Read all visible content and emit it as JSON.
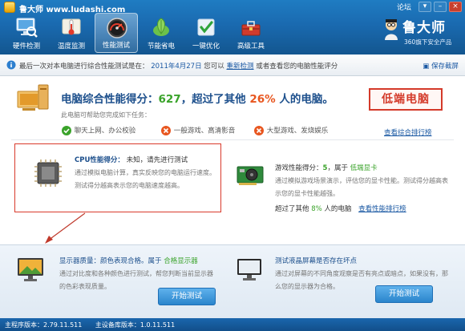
{
  "titlebar": {
    "app_name": "鲁大师 www.ludashi.com",
    "forum": "论坛",
    "menu_glyph": "▾",
    "min_glyph": "–",
    "close_glyph": "×"
  },
  "nav": [
    {
      "label": "硬件检测",
      "icon": "hardware-monitor-icon",
      "active": false
    },
    {
      "label": "温度监测",
      "icon": "thermometer-icon",
      "active": false
    },
    {
      "label": "性能测试",
      "icon": "speedometer-icon",
      "active": true
    },
    {
      "label": "节能省电",
      "icon": "leaf-icon",
      "active": false
    },
    {
      "label": "一键优化",
      "icon": "checkmark-icon",
      "active": false
    },
    {
      "label": "高级工具",
      "icon": "toolbox-icon",
      "active": false
    }
  ],
  "brand": {
    "name": "鲁大师",
    "slogan": "360旗下安全产品"
  },
  "infobar": {
    "text_prefix": "最后一次对本电脑进行综合性能测试是在：",
    "date": "2011年4月27日",
    "text_mid": "您可以",
    "retest_link": "重新检测",
    "text_suffix": "或者查看您的电脑性能评分",
    "save_screenshot": "保存截屏"
  },
  "score": {
    "prefix": "电脑综合性能得分：",
    "value": "627",
    "middle": "，超过了其他",
    "percent": "26%",
    "suffix": "人的电脑。",
    "hint": "此电脑可帮助您完成如下任务：",
    "stamp": "低端电脑"
  },
  "capabilities": [
    {
      "label": "聊天上网、办公校验",
      "supported": true
    },
    {
      "label": "一般游戏、高清影音",
      "supported": false
    },
    {
      "label": "大型游戏、发烧娱乐",
      "supported": false
    }
  ],
  "rank_link": "查看综合排行榜",
  "cpu": {
    "title": "CPU性能得分：",
    "status": "未知，请先进行测试",
    "desc": "通过模拟电脑计算，真实反映您的电脑运行速度。测试得分越高表示您的电脑速度越高。"
  },
  "gpu": {
    "title": "游戏性能得分：",
    "score": "5",
    "tier_prefix": "，属于",
    "tier": "低端显卡",
    "desc": "通过模拟游戏场景演示，评估您的显卡性能。测试得分越高表示您的显卡性能越强。",
    "beat_prefix": "超过了其他",
    "beat_pct": "8%",
    "beat_suffix": "人的电脑",
    "rank_link": "查看性能排行榜"
  },
  "monitor": {
    "title": "显示器质量：颜色表现合格。属于",
    "tier": "合格显示器",
    "desc": "通过对比度和各种颜色进行测试，帮您判断当前显示器的色彩表现质量。",
    "button": "开始测试"
  },
  "lcd": {
    "title": "测试液晶屏幕是否存在坏点",
    "desc": "通过对屏幕的不同角度观察是否有亮点或暗点，如果没有，那么您的显示器为合格。",
    "button": "开始测试"
  },
  "status": {
    "program_version": "主程序版本：2.79.11.511",
    "db_version": "主设备库版本：1.0.11.511"
  },
  "colors": {
    "header": "#1a6ab0",
    "accent_green": "#3aa32a",
    "accent_orange": "#e8561f",
    "stamp_red": "#d43a2a",
    "link_blue": "#1a58a3"
  }
}
